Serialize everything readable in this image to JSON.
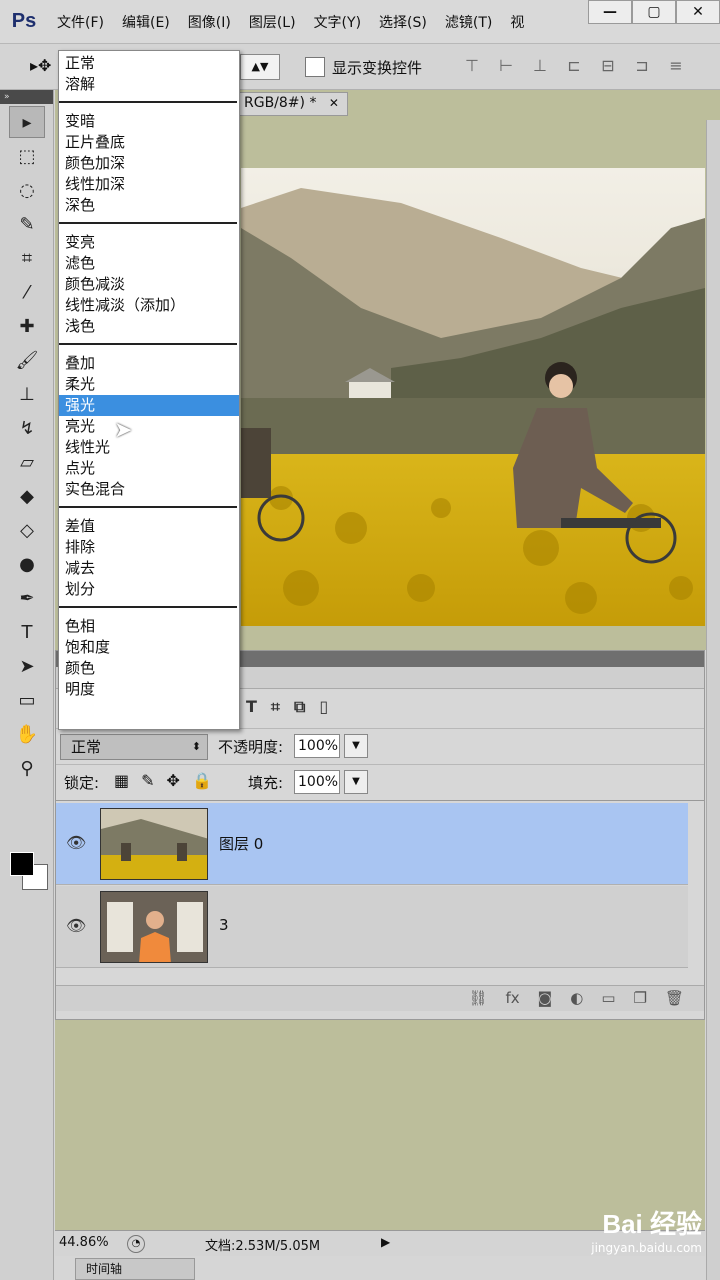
{
  "app": {
    "logo": "Ps"
  },
  "menubar": {
    "items": [
      "文件(F)",
      "编辑(E)",
      "图像(I)",
      "图层(L)",
      "文字(Y)",
      "选择(S)",
      "滤镜(T)",
      "视"
    ]
  },
  "window_controls": {
    "minimize": "—",
    "restore": "▢",
    "close": "✕"
  },
  "options_bar": {
    "show_transform_controls": "显示变换控件",
    "select_arrow": "▲▼"
  },
  "document": {
    "tab_label": "RGB/8#) *",
    "tab_close": "✕"
  },
  "blend_menu": {
    "groups": [
      [
        "正常",
        "溶解"
      ],
      [
        "变暗",
        "正片叠底",
        "颜色加深",
        "线性加深",
        "深色"
      ],
      [
        "变亮",
        "滤色",
        "颜色减淡",
        "线性减淡（添加）",
        "浅色"
      ],
      [
        "叠加",
        "柔光",
        "强光",
        "亮光",
        "线性光",
        "点光",
        "实色混合"
      ],
      [
        "差值",
        "排除",
        "减去",
        "划分"
      ],
      [
        "色相",
        "饱和度",
        "颜色",
        "明度"
      ]
    ],
    "selected": "强光"
  },
  "layers_panel": {
    "blend_mode": "正常",
    "opacity_label": "不透明度:",
    "opacity_value": "100%",
    "lock_label": "锁定:",
    "fill_label": "填充:",
    "fill_value": "100%",
    "layers": [
      {
        "name": "图层 0",
        "selected": true
      },
      {
        "name": "3",
        "selected": false
      }
    ]
  },
  "status_bar": {
    "zoom": "44.86%",
    "doc_size": "文档:2.53M/5.05M"
  },
  "timeline_tab": "时间轴",
  "watermark": {
    "logo": "Bai 经验",
    "url": "jingyan.baidu.com"
  }
}
